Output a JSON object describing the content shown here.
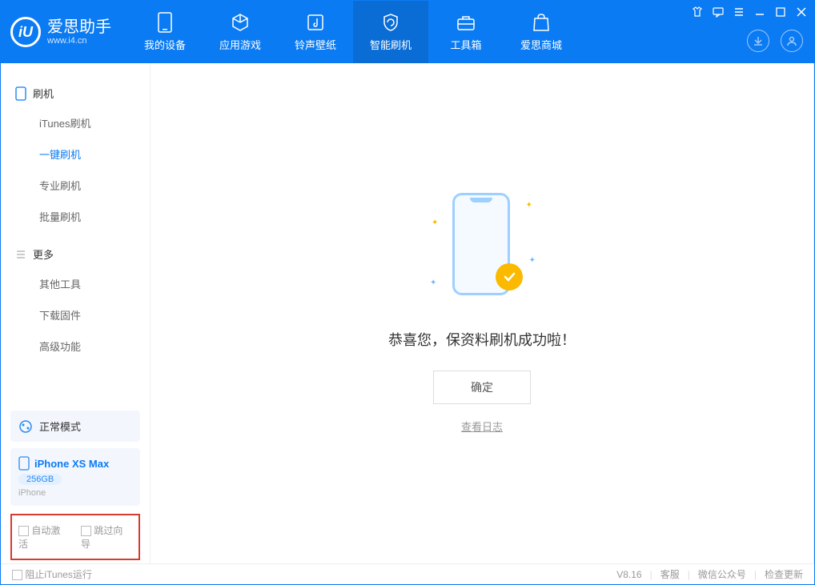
{
  "app": {
    "name": "爱思助手",
    "domain": "www.i4.cn",
    "version": "V8.16"
  },
  "nav": {
    "items": [
      {
        "label": "我的设备"
      },
      {
        "label": "应用游戏"
      },
      {
        "label": "铃声壁纸"
      },
      {
        "label": "智能刷机"
      },
      {
        "label": "工具箱"
      },
      {
        "label": "爱思商城"
      }
    ],
    "active_index": 3
  },
  "sidebar": {
    "section1": {
      "title": "刷机",
      "items": [
        {
          "label": "iTunes刷机"
        },
        {
          "label": "一键刷机"
        },
        {
          "label": "专业刷机"
        },
        {
          "label": "批量刷机"
        }
      ],
      "active_index": 1
    },
    "section2": {
      "title": "更多",
      "items": [
        {
          "label": "其他工具"
        },
        {
          "label": "下载固件"
        },
        {
          "label": "高级功能"
        }
      ]
    },
    "mode": {
      "label": "正常模式"
    },
    "device": {
      "name": "iPhone XS Max",
      "capacity": "256GB",
      "type": "iPhone"
    },
    "checkboxes": {
      "auto_activate": "自动激活",
      "skip_guide": "跳过向导"
    }
  },
  "main": {
    "success_text": "恭喜您，保资料刷机成功啦！",
    "ok_button": "确定",
    "log_link": "查看日志"
  },
  "status": {
    "block_itunes": "阻止iTunes运行",
    "links": {
      "kefu": "客服",
      "wechat": "微信公众号",
      "update": "检查更新"
    }
  }
}
